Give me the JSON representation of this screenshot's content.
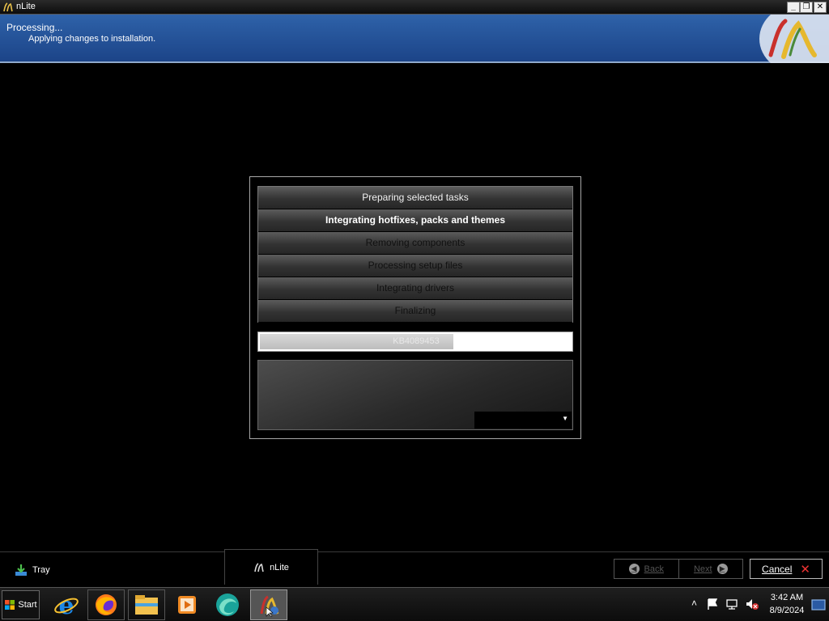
{
  "window": {
    "title": "nLite"
  },
  "header": {
    "title": "Processing...",
    "subtitle": "Applying changes to installation."
  },
  "tasks": [
    {
      "label": "Preparing selected tasks",
      "state": "done"
    },
    {
      "label": "Integrating hotfixes, packs and themes",
      "state": "active"
    },
    {
      "label": "Removing components",
      "state": "pending"
    },
    {
      "label": "Processing setup files",
      "state": "pending"
    },
    {
      "label": "Integrating drivers",
      "state": "pending"
    },
    {
      "label": "Finalizing",
      "state": "pending"
    }
  ],
  "progress": {
    "label": "KB4089453",
    "fraction": 0.64
  },
  "bottom": {
    "tray_label": "Tray",
    "app_tab_label": "nLite",
    "back_label": "Back",
    "next_label": "Next",
    "cancel_label": "Cancel"
  },
  "taskbar": {
    "start_label": "Start",
    "apps": [
      "internet-explorer-icon",
      "firefox-icon",
      "file-explorer-icon",
      "media-player-icon",
      "browser-globe-icon",
      "nlite-icon"
    ],
    "clock_time": "3:42 AM",
    "clock_date": "8/9/2024"
  },
  "colors": {
    "header_blue": "#2a5aa3",
    "cancel_x": "#e33333"
  }
}
